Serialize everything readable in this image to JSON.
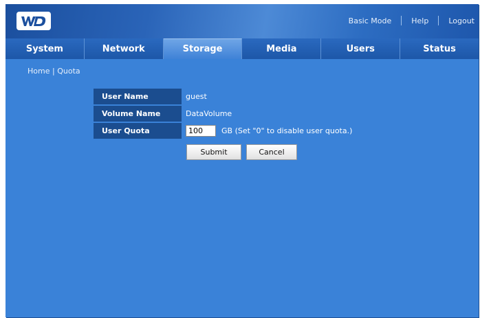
{
  "header": {
    "logo_text": "WD",
    "links": {
      "basic_mode": "Basic Mode",
      "help": "Help",
      "logout": "Logout"
    }
  },
  "nav": {
    "tabs": [
      {
        "label": "System",
        "active": false
      },
      {
        "label": "Network",
        "active": false
      },
      {
        "label": "Storage",
        "active": true
      },
      {
        "label": "Media",
        "active": false
      },
      {
        "label": "Users",
        "active": false
      },
      {
        "label": "Status",
        "active": false
      }
    ]
  },
  "breadcrumb": {
    "home": "Home",
    "separator": "|",
    "current": "Quota"
  },
  "form": {
    "user_name_label": "User Name",
    "user_name_value": "guest",
    "volume_name_label": "Volume Name",
    "volume_name_value": "DataVolume",
    "user_quota_label": "User Quota",
    "user_quota_value": "100",
    "user_quota_hint": "GB (Set \"0\" to disable user quota.)"
  },
  "buttons": {
    "submit": "Submit",
    "cancel": "Cancel"
  },
  "colors": {
    "page_background": "#3a82d8",
    "label_background": "#1b4d8f",
    "active_tab": "#5a97e0"
  }
}
